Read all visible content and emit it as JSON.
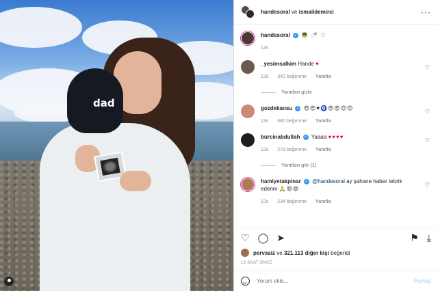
{
  "post": {
    "author": "handesoral",
    "coauthor": "ismaildemirci",
    "and_word": "ve",
    "cap_text": "dad"
  },
  "caption": {
    "username": "handesoral",
    "emojis": "👼 🍼 ♡",
    "time": "13s"
  },
  "comments": [
    {
      "username": "_yesimsalkim",
      "verified": false,
      "text": "Hande",
      "suffix": "♥",
      "time": "13s",
      "likes": "342 beğenme",
      "reply": "Yanıtla",
      "replies_label": "Yanıtları gizle"
    },
    {
      "username": "gozdekansu",
      "verified": true,
      "text": "",
      "suffix": "😍😍♥🧿😍😍😊😊",
      "time": "13s",
      "likes": "680 beğenme",
      "reply": "Yanıtla",
      "replies_label": ""
    },
    {
      "username": "burcinabdullah",
      "verified": true,
      "text": "Yaaaa",
      "suffix": "♥♥♥♥",
      "time": "12s",
      "likes": "279 beğenme",
      "reply": "Yanıtla",
      "replies_label": "Yanıtları gör (1)"
    },
    {
      "username": "hamiyetakpinar",
      "verified": true,
      "mention": "@handesoral",
      "text": "ay şahane haber tebrik ederim",
      "suffix": "🙏😍😍",
      "time": "12s",
      "likes": "234 beğenme",
      "reply": "Yanıtla",
      "replies_label": ""
    }
  ],
  "likes": {
    "liker": "pervasiz",
    "and_word": "ve",
    "count": "321.113",
    "rest": "diğer kişi",
    "verb": "beğendi"
  },
  "timestamp": "13 SAAT ÖNCE",
  "add_comment": {
    "placeholder": "Yorum ekle...",
    "post_label": "Paylaş"
  },
  "more_label": "···",
  "colors": {
    "verified": "#3897f0",
    "heart": "#e0102d",
    "mention": "#00376b",
    "post_disabled": "#b2dffc"
  }
}
